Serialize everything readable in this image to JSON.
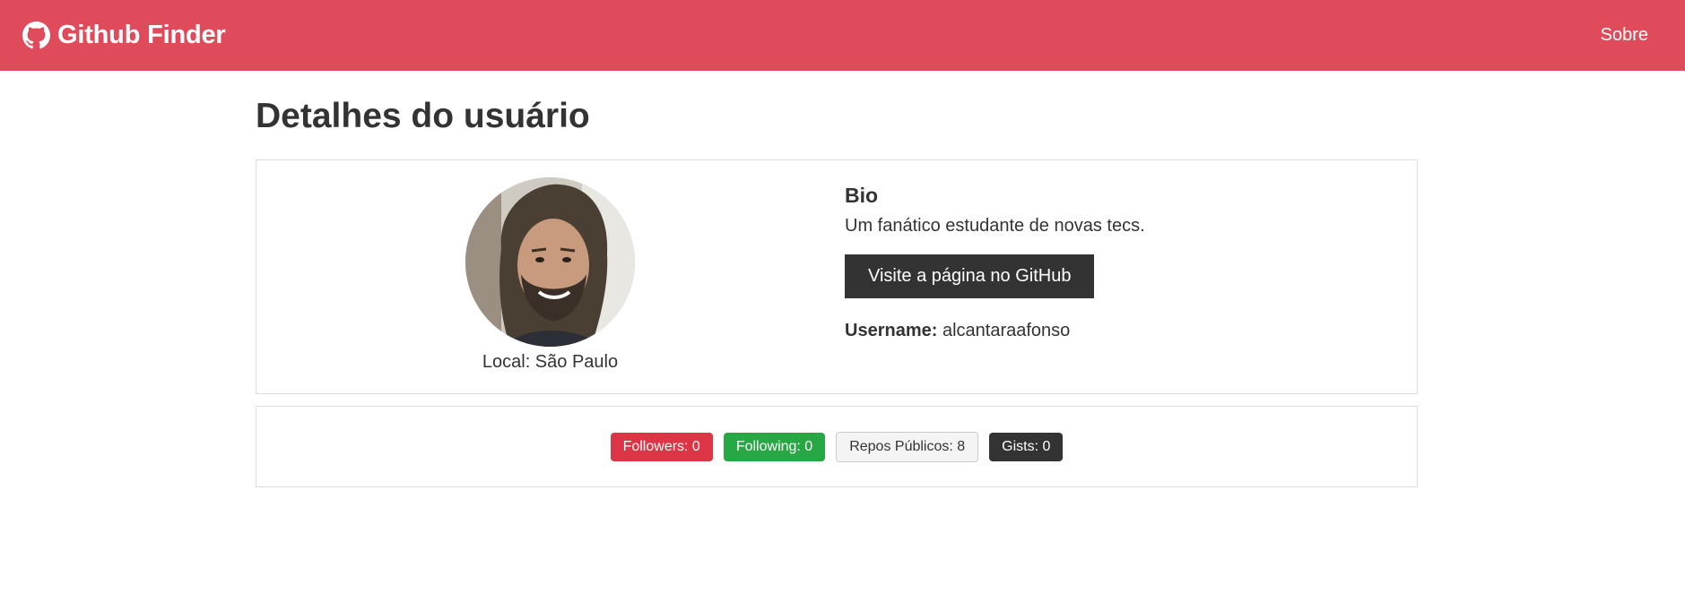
{
  "navbar": {
    "brand": "Github Finder",
    "brand_icon": "github-icon",
    "link_about": "Sobre",
    "bg_color": "#e04b5b"
  },
  "page": {
    "title": "Detalhes do usuário"
  },
  "profile": {
    "location_label": "Local: São Paulo",
    "bio_title": "Bio",
    "bio_text": "Um fanático estudante de novas tecs.",
    "github_button": "Visite a página no GitHub",
    "username_label": "Username:",
    "username_value": " alcantaraafonso"
  },
  "stats": {
    "followers": "Followers: 0",
    "following": "Following: 0",
    "repos": "Repos Públicos: 8",
    "gists": "Gists: 0"
  },
  "colors": {
    "primary": "#dc3545",
    "success": "#28a745",
    "light": "#f4f4f4",
    "dark": "#333333"
  }
}
